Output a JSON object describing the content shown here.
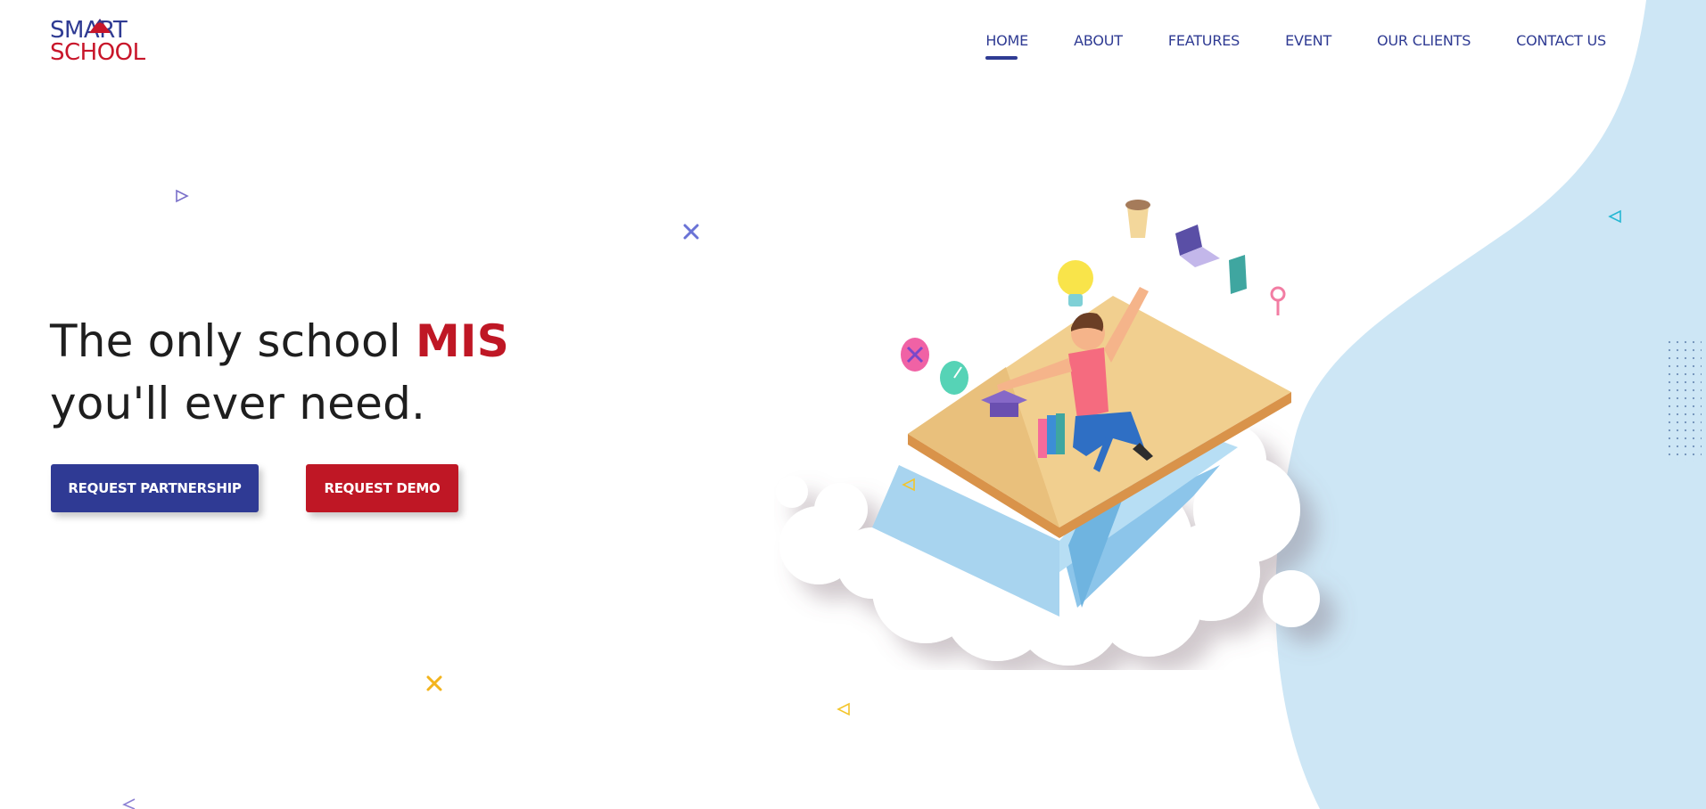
{
  "brand": {
    "line1": "SMART",
    "line2": "SCHOOL",
    "colors": {
      "primary": "#2f3b93",
      "accent": "#c8162a"
    }
  },
  "nav": {
    "items": [
      {
        "label": "HOME",
        "active": true
      },
      {
        "label": "ABOUT",
        "active": false
      },
      {
        "label": "FEATURES",
        "active": false
      },
      {
        "label": "EVENT",
        "active": false
      },
      {
        "label": "OUR CLIENTS",
        "active": false
      },
      {
        "label": "CONTACT US",
        "active": false
      }
    ]
  },
  "hero": {
    "title_part1": "The only school ",
    "title_accent": "MIS",
    "title_line2": "you'll ever need."
  },
  "buttons": {
    "partner_label": "REQUEST PARTNERSHIP",
    "demo_label": "REQUEST DEMO"
  },
  "colors": {
    "primary": "#2f3a94",
    "accent": "#bf1725",
    "wave": "#cde6f5",
    "text": "#1e1e1e"
  },
  "illustration": {
    "icons": [
      "coffee-cup-icon",
      "laptop-icon",
      "calculator-icon",
      "magnifier-icon",
      "lightbulb-icon",
      "clock-icon",
      "graduation-cap-icon",
      "books-icon",
      "beach-ball-icon"
    ]
  }
}
